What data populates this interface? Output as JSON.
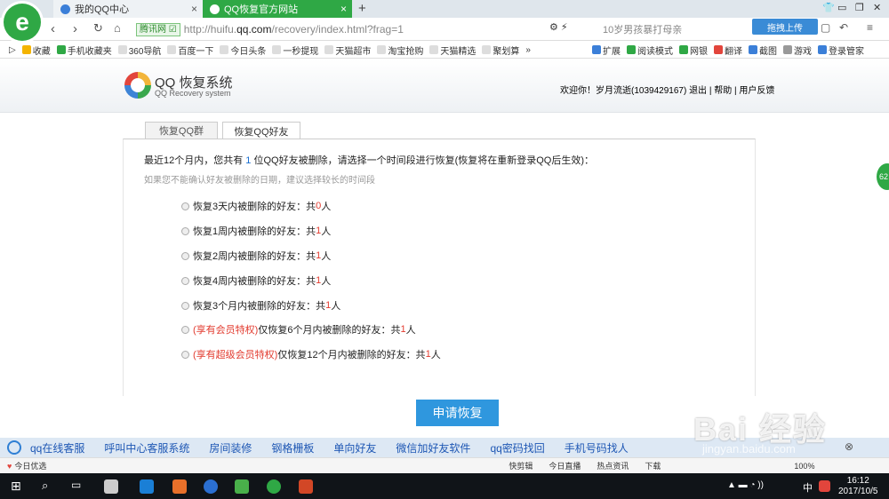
{
  "browser": {
    "logo_glyph": "e",
    "tabs": [
      {
        "label": "我的QQ中心"
      },
      {
        "label": "QQ恢复官方网站"
      }
    ],
    "new_tab": "+",
    "address": {
      "badge": "腾讯网 ☑",
      "url_prefix": "http://huifu.",
      "url_domain": "qq.com",
      "url_suffix": "/recovery/index.html?frag=1"
    },
    "search_text": "10岁男孩暴打母亲",
    "upload_label": "拖拽上传",
    "bookmarks": [
      "收藏",
      "手机收藏夹",
      "360导航",
      "百度一下",
      "今日头条",
      "一秒提现",
      "天猫超市",
      "淘宝抢购",
      "天猫精选",
      "聚划算"
    ],
    "tools": [
      "扩展",
      "阅读模式",
      "网银",
      "翻译",
      "截图",
      "游戏",
      "登录管家"
    ]
  },
  "site": {
    "title": "QQ 恢复系统",
    "subtitle": "QQ Recovery system",
    "welcome": "欢迎你！岁月流逝(1039429167)",
    "logout": "退出",
    "help": "帮助",
    "feedback": "用户反馈"
  },
  "tabs": {
    "groups": "恢复QQ群",
    "friends": "恢复QQ好友"
  },
  "intro": {
    "before": "最近12个月内，您共有 ",
    "count": "1",
    "after": " 位QQ好友被删除，请选择一个时间段进行恢复(恢复将在重新登录QQ后生效)："
  },
  "hint": "如果您不能确认好友被删除的日期，建议选择较长的时间段",
  "options": [
    {
      "prefix": "",
      "text": "恢复3天内被删除的好友：共 ",
      "count": "0",
      "unit": " 人"
    },
    {
      "prefix": "",
      "text": "恢复1周内被删除的好友：共 ",
      "count": "1",
      "unit": " 人"
    },
    {
      "prefix": "",
      "text": "恢复2周内被删除的好友：共 ",
      "count": "1",
      "unit": " 人"
    },
    {
      "prefix": "",
      "text": "恢复4周内被删除的好友：共 ",
      "count": "1",
      "unit": " 人"
    },
    {
      "prefix": "",
      "text": "恢复3个月内被删除的好友：共 ",
      "count": "1",
      "unit": " 人"
    },
    {
      "prefix": "(享有会员特权)",
      "text": "仅恢复6个月内被删除的好友：共 ",
      "count": "1",
      "unit": " 人"
    },
    {
      "prefix": "(享有超级会员特权)",
      "text": "仅恢复12个月内被删除的好友：共 ",
      "count": "1",
      "unit": " 人"
    }
  ],
  "apply_label": "申请恢复",
  "side_badge": "62",
  "promo": [
    "qq在线客服",
    "呼叫中心客服系统",
    "房间装修",
    "钢格栅板",
    "单向好友",
    "微信加好友软件",
    "qq密码找回",
    "手机号码找人"
  ],
  "statusbar": {
    "left": "今日优选",
    "items": [
      "快剪辑",
      "今日直播",
      "热点资讯",
      "下载"
    ],
    "zoom": "100%"
  },
  "taskbar": {
    "ime": "中",
    "time": "16:12",
    "date": "2017/10/5"
  },
  "watermark": {
    "main": "Bai 经验",
    "sub": "jingyan.baidu.com"
  }
}
